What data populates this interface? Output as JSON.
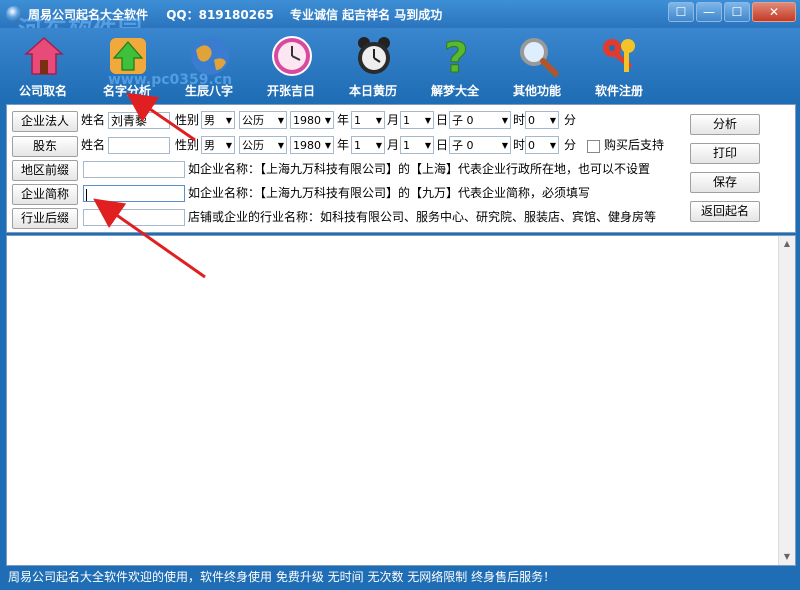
{
  "window": {
    "title": "周易公司起名大全软件",
    "qq_text": "QQ：819180265",
    "slogan": "专业诚信  起吉祥名  马到成功",
    "watermark": "河东软件园",
    "watermark_url": "www.pc0359.cn",
    "buttons": [
      "☐",
      "—",
      "☐",
      "✕"
    ]
  },
  "toolbar": {
    "items": [
      {
        "label": "公司取名",
        "icon": "house-icon",
        "color": "#e84b7a"
      },
      {
        "label": "名字分析",
        "icon": "green-arrow-up-icon",
        "color": "#3fbf3a"
      },
      {
        "label": "生辰八字",
        "icon": "globe-icon",
        "color": "#d99a2b"
      },
      {
        "label": "开张吉日",
        "icon": "clock-icon",
        "color": "#d94a9f"
      },
      {
        "label": "本日黄历",
        "icon": "alarm-clock-icon",
        "color": "#333333"
      },
      {
        "label": "解梦大全",
        "icon": "question-mark-icon",
        "color": "#59b92e"
      },
      {
        "label": "其他功能",
        "icon": "magnifier-icon",
        "color": "#aaaaaa"
      },
      {
        "label": "软件注册",
        "icon": "keys-icon",
        "color": "#e23b2b"
      }
    ]
  },
  "form": {
    "row1": {
      "button": "企业法人",
      "name_label": "姓名",
      "name_value": "刘青藜",
      "gender_label": "性别",
      "gender": "男",
      "calendar": "公历",
      "year": "1980",
      "year_unit": "年",
      "month": "1",
      "month_unit": "月",
      "day": "1",
      "day_unit": "日",
      "hour_branch": "子 0",
      "hour_unit": "时",
      "minute": "0",
      "minute_unit": "分"
    },
    "row2": {
      "button": "股东",
      "name_label": "姓名",
      "name_value": "",
      "gender_label": "性别",
      "gender": "男",
      "calendar": "公历",
      "year": "1980",
      "year_unit": "年",
      "month": "1",
      "month_unit": "月",
      "day": "1",
      "day_unit": "日",
      "hour_branch": "子 0",
      "hour_unit": "时",
      "minute": "0",
      "minute_unit": "分",
      "checkbox_label": "购买后支持"
    },
    "row3": {
      "button": "地区前缀",
      "hint": "如企业名称：【上海九万科技有限公司】的【上海】代表企业行政所在地，也可以不设置"
    },
    "row4": {
      "button": "企业简称",
      "hint": "如企业名称：【上海九万科技有限公司】的【九万】代表企业简称，必须填写"
    },
    "row5": {
      "button": "行业后缀",
      "hint": "店铺或企业的行业名称：如科技有限公司、服务中心、研究院、服装店、宾馆、健身房等"
    },
    "actions": {
      "analyze": "分析",
      "print": "打印",
      "save": "保存",
      "back": "返回起名"
    }
  },
  "status": {
    "text": "周易公司起名大全软件欢迎的使用，软件终身使用  免费升级  无时间  无次数  无网络限制  终身售后服务！"
  }
}
